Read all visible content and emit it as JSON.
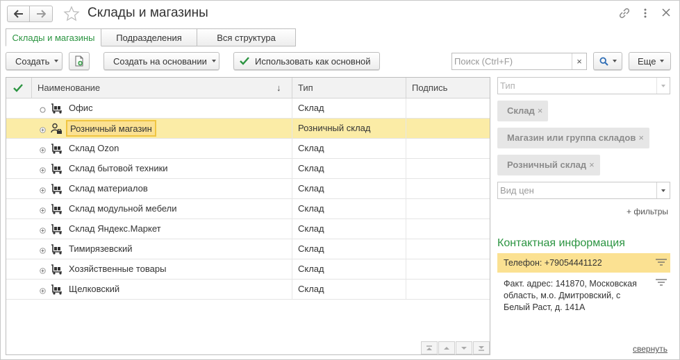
{
  "window": {
    "title": "Склады и магазины"
  },
  "tabs": [
    {
      "label": "Склады и магазины",
      "active": true
    },
    {
      "label": "Подразделения",
      "active": false
    },
    {
      "label": "Вся структура",
      "active": false
    }
  ],
  "toolbar": {
    "create_label": "Создать",
    "create_based_label": "Создать на основании",
    "use_as_main_label": "Использовать как основной",
    "search_placeholder": "Поиск (Ctrl+F)",
    "search_clear": "×",
    "more_label": "Еще"
  },
  "table": {
    "columns": {
      "name": "Наименование",
      "sort_arrow": "↓",
      "type": "Тип",
      "signature": "Подпись"
    },
    "rows": [
      {
        "name": "Офис",
        "type": "Склад",
        "selected": false,
        "expander": "circle",
        "icon": "warehouse-icon"
      },
      {
        "name": "Розничный магазин",
        "type": "Розничный склад",
        "selected": true,
        "expander": "plus",
        "icon": "retail-store-icon"
      },
      {
        "name": "Склад Ozon",
        "type": "Склад",
        "selected": false,
        "expander": "plus",
        "icon": "warehouse-icon"
      },
      {
        "name": "Склад бытовой техники",
        "type": "Склад",
        "selected": false,
        "expander": "plus",
        "icon": "warehouse-icon"
      },
      {
        "name": "Склад материалов",
        "type": "Склад",
        "selected": false,
        "expander": "plus",
        "icon": "warehouse-icon"
      },
      {
        "name": "Склад модульной мебели",
        "type": "Склад",
        "selected": false,
        "expander": "plus",
        "icon": "warehouse-icon"
      },
      {
        "name": "Склад Яндекс.Маркет",
        "type": "Склад",
        "selected": false,
        "expander": "plus",
        "icon": "warehouse-icon"
      },
      {
        "name": "Тимирязевский",
        "type": "Склад",
        "selected": false,
        "expander": "plus",
        "icon": "warehouse-icon"
      },
      {
        "name": "Хозяйственные товары",
        "type": "Склад",
        "selected": false,
        "expander": "plus",
        "icon": "warehouse-icon"
      },
      {
        "name": "Щелковский",
        "type": "Склад",
        "selected": false,
        "expander": "plus",
        "icon": "warehouse-icon"
      }
    ]
  },
  "filters": {
    "type_placeholder": "Тип",
    "chips": [
      {
        "label": "Склад",
        "x": "×"
      },
      {
        "label": "Магазин или группа складов",
        "x": "×"
      },
      {
        "label": "Розничный склад",
        "x": "×"
      }
    ],
    "price_type_placeholder": "Вид цен",
    "more_filters_label": "+ фильтры"
  },
  "contact": {
    "title": "Контактная информация",
    "phone": "Телефон: +79054441122",
    "address_lines": [
      "Факт. адрес: 141870, Московская",
      "область, м.о. Дмитровский, с",
      "Белый Раст, д. 141А"
    ],
    "collapse_label": "свернуть"
  },
  "colors": {
    "accent_green": "#2b9441",
    "selection_yellow": "#fbeca6",
    "highlight_yellow": "#fbe192"
  }
}
